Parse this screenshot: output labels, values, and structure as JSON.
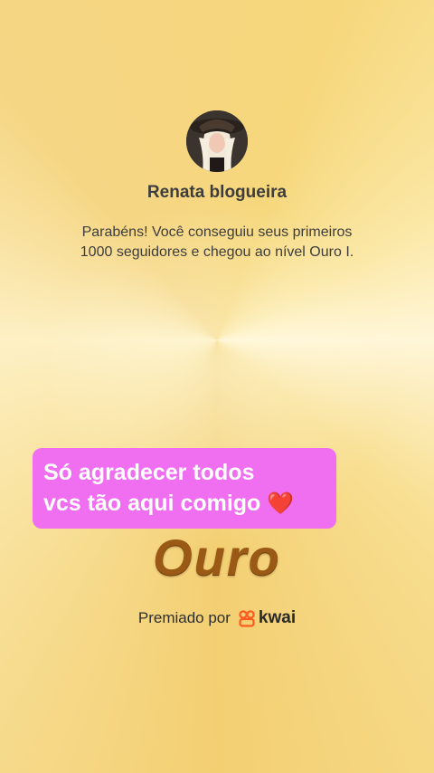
{
  "profile": {
    "name": "Renata blogueira",
    "avatar_icon": "profile-photo"
  },
  "message": {
    "line1": "Parabéns! Você conseguiu seus primeiros",
    "line2": "1000 seguidores e chegou ao nível Ouro I."
  },
  "caption": {
    "line1": "Só agradecer todos",
    "line2": "vcs tão aqui comigo",
    "emoji": "❤️"
  },
  "level": {
    "title": "Ouro"
  },
  "award": {
    "label": "Premiado por",
    "brand": "kwai",
    "brand_icon": "kwai-logo-icon",
    "brand_color": "#ff5a1f"
  },
  "colors": {
    "caption_bg": "#ef6ff0",
    "level_text": "#9a5a16",
    "background": "#f6d77c"
  }
}
